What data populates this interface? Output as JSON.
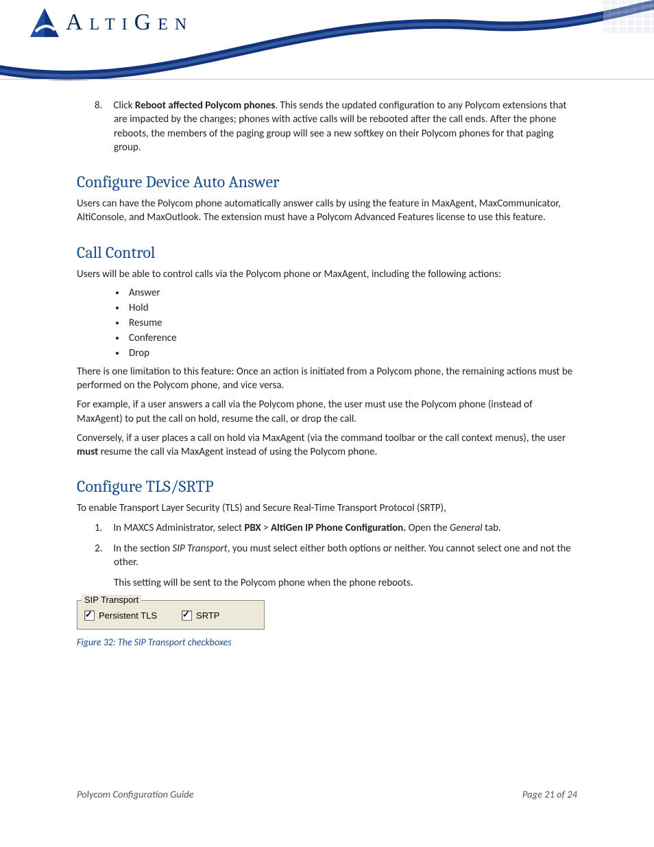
{
  "logo_text": "AltiGen",
  "step8": {
    "num": "8.",
    "prefix": "Click ",
    "bold": "Reboot affected Polycom phones",
    "suffix": ". This sends the updated configuration to any Polycom extensions that are impacted by the changes; phones with active calls will be rebooted after the call ends. After the phone reboots, the members of the paging group will see a new softkey on their Polycom phones for that paging group."
  },
  "sec_auto": {
    "title": "Configure Device Auto Answer",
    "p1": "Users can have the Polycom phone automatically answer calls by using the feature in MaxAgent, MaxCommunicator, AltiConsole, and MaxOutlook.  The extension must have a Polycom Advanced Features license to use this feature."
  },
  "sec_call": {
    "title": "Call Control",
    "intro": "Users will be able to control calls via the Polycom phone or MaxAgent, including the following actions:",
    "bullets": [
      "Answer",
      "Hold",
      "Resume",
      "Conference",
      " Drop"
    ],
    "p2": "There is one limitation to this feature:  Once an action is initiated from a Polycom phone, the remaining actions must be performed on the Polycom phone, and vice versa.",
    "p3": "For example, if a user answers a call via the Polycom phone, the user must use the Polycom phone (instead of MaxAgent) to put the call on hold, resume the call, or drop the call.",
    "p4a": "Conversely, if a user places a call on hold via MaxAgent (via the command toolbar or the call context menus), the user ",
    "p4b": "must",
    "p4c": " resume the call via MaxAgent instead of using the Polycom phone."
  },
  "sec_tls": {
    "title": "Configure TLS/SRTP",
    "p1": "To enable Transport Layer Security (TLS) and Secure Real-Time Transport Protocol (SRTP),",
    "step1": {
      "num": "1.",
      "a": "In MAXCS Administrator, select ",
      "b": "PBX",
      "c": " > ",
      "d": "AltiGen IP Phone Configuration.",
      "e": " Open the ",
      "f": "General",
      "g": " tab."
    },
    "step2": {
      "num": "2.",
      "a": "In the section ",
      "b": "SIP Transport",
      "c": ", you must select either both options or neither. You cannot select one and not the other."
    },
    "p2": "This setting will be sent to the Polycom phone when the phone reboots."
  },
  "figure": {
    "legend": "SIP Transport",
    "cb1": "Persistent TLS",
    "cb2": "SRTP",
    "caption": "Figure 32: The SIP Transport checkboxes"
  },
  "footer": {
    "left": "Polycom Configuration Guide",
    "right": "Page 21 of 24"
  }
}
